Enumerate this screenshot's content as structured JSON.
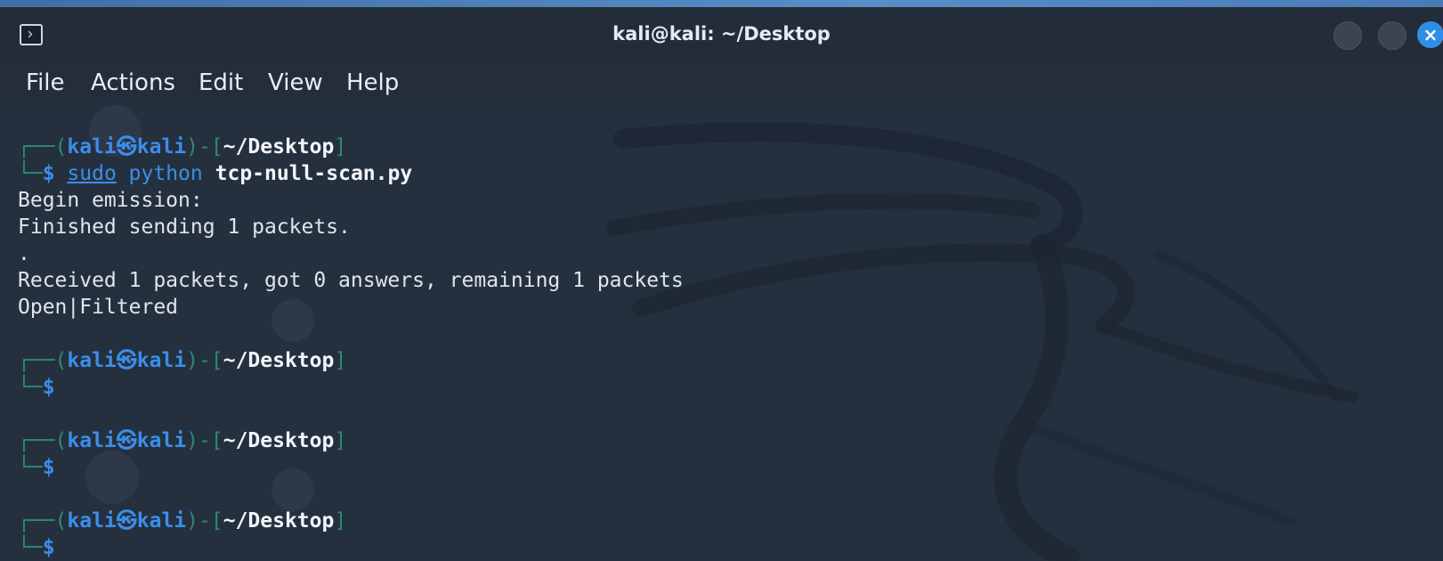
{
  "window": {
    "title": "kali@kali: ~/Desktop",
    "close_glyph": "×",
    "icons": {
      "app": "terminal-icon",
      "minimize": "minimize-icon",
      "maximize": "maximize-icon",
      "close": "close-icon"
    },
    "accent_color": "#2f8fe6"
  },
  "menu": {
    "items": [
      "File",
      "Actions",
      "Edit",
      "View",
      "Help"
    ]
  },
  "prompt": {
    "corner_top": "┌──(",
    "user": "kali",
    "symbol": "㉿",
    "host": "kali",
    "mid": ")-[",
    "path": "~/Desktop",
    "end": "]",
    "corner_bottom": "└─",
    "dollar": "$"
  },
  "session": {
    "command": {
      "sudo": "sudo",
      "program": "python",
      "script": "tcp-null-scan.py"
    },
    "output": [
      "Begin emission:",
      "Finished sending 1 packets.",
      ".",
      "Received 1 packets, got 0 answers, remaining 1 packets",
      "Open|Filtered"
    ]
  },
  "colors": {
    "prompt_frame": "#2f8a6b",
    "prompt_user": "#3b8eea",
    "background": "#25303f"
  }
}
